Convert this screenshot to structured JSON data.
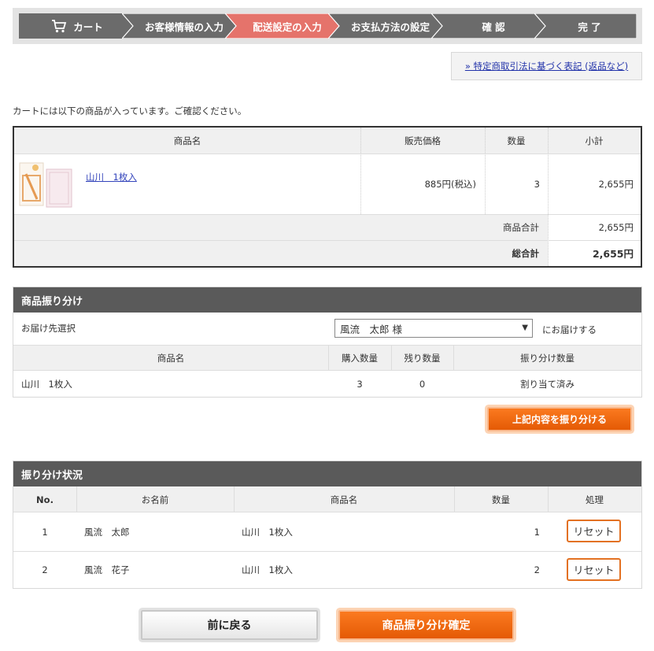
{
  "steps": [
    {
      "label": "カート",
      "icon": "cart-icon"
    },
    {
      "label": "お客様情報の入力"
    },
    {
      "label": "配送設定の入力",
      "active": true
    },
    {
      "label": "お支払方法の設定"
    },
    {
      "label": "確 認"
    },
    {
      "label": "完 了"
    }
  ],
  "colors": {
    "step_bg": "#6b6b6b",
    "step_active": "#e5736b",
    "orange": "#f0670c",
    "section_header": "#5a5a5a"
  },
  "law_link": "» 特定商取引法に基づく表記 (返品など)",
  "intro": "カートには以下の商品が入っています。ご確認ください。",
  "cart": {
    "headers": {
      "name": "商品名",
      "price": "販売価格",
      "qty": "数量",
      "subtotal": "小計"
    },
    "item": {
      "name": "山川　1枚入",
      "price": "885円(税込)",
      "qty": "3",
      "subtotal": "2,655円",
      "image": "product-thumbnail"
    },
    "goods_total_label": "商品合計",
    "goods_total": "2,655円",
    "grand_total_label": "総合計",
    "grand_total": "2,655円"
  },
  "allocation": {
    "title": "商品振り分け",
    "dest_label": "お届け先選択",
    "dest_value": "風流　太郎 様",
    "dest_suffix": "にお届けする",
    "headers": {
      "name": "商品名",
      "bought": "購入数量",
      "remaining": "残り数量",
      "alloc": "振り分け数量"
    },
    "row": {
      "name": "山川　1枚入",
      "bought": "3",
      "remaining": "0",
      "alloc": "割り当て済み"
    },
    "button": "上記内容を振り分ける"
  },
  "status": {
    "title": "振り分け状況",
    "headers": {
      "no": "No.",
      "recipient": "お名前",
      "name": "商品名",
      "qty": "数量",
      "action": "処理"
    },
    "rows": [
      {
        "no": "1",
        "recipient": "風流　太郎",
        "name": "山川　1枚入",
        "qty": "1",
        "action": "リセット"
      },
      {
        "no": "2",
        "recipient": "風流　花子",
        "name": "山川　1枚入",
        "qty": "2",
        "action": "リセット"
      }
    ]
  },
  "buttons": {
    "back": "前に戻る",
    "confirm": "商品振り分け確定"
  }
}
